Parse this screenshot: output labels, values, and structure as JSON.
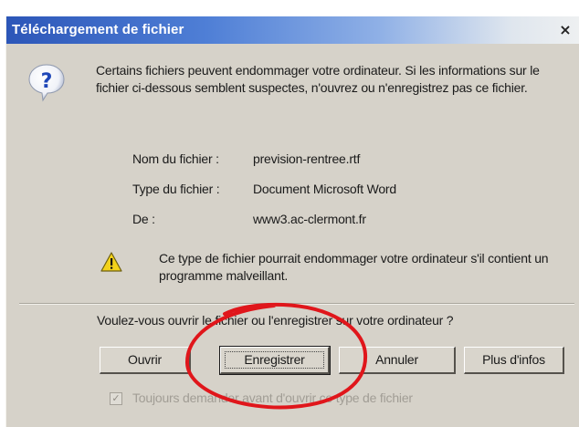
{
  "dialog": {
    "title": "Téléchargement de fichier",
    "close_glyph": "×",
    "intro_text": "Certains fichiers peuvent endommager votre ordinateur. Si les informations sur le fichier ci-dessous semblent suspectes, n'ouvrez ou n'enregistrez pas ce fichier.",
    "file_info": {
      "name_label": "Nom du fichier :",
      "name_value": "prevision-rentree.rtf",
      "type_label": "Type du fichier :",
      "type_value": "Document Microsoft Word",
      "from_label": "De :",
      "from_value": "www3.ac-clermont.fr"
    },
    "warning_text": "Ce type de fichier pourrait endommager votre ordinateur s'il contient un programme malveillant.",
    "question": "Voulez-vous ouvrir le fichier ou l'enregistrer sur votre ordinateur ?",
    "buttons": {
      "open": "Ouvrir",
      "save": "Enregistrer",
      "cancel": "Annuler",
      "more_info": "Plus d'infos"
    },
    "checkbox_label": "Toujours demander avant d'ouvrir ce type de fichier",
    "checkbox_glyph": "✓",
    "icons": {
      "question": "question-icon",
      "warning": "warning-icon"
    },
    "colors": {
      "dialog_bg": "#d6d2c9",
      "title_start": "#2c56b8",
      "highlight_circle": "#e0161b"
    }
  }
}
